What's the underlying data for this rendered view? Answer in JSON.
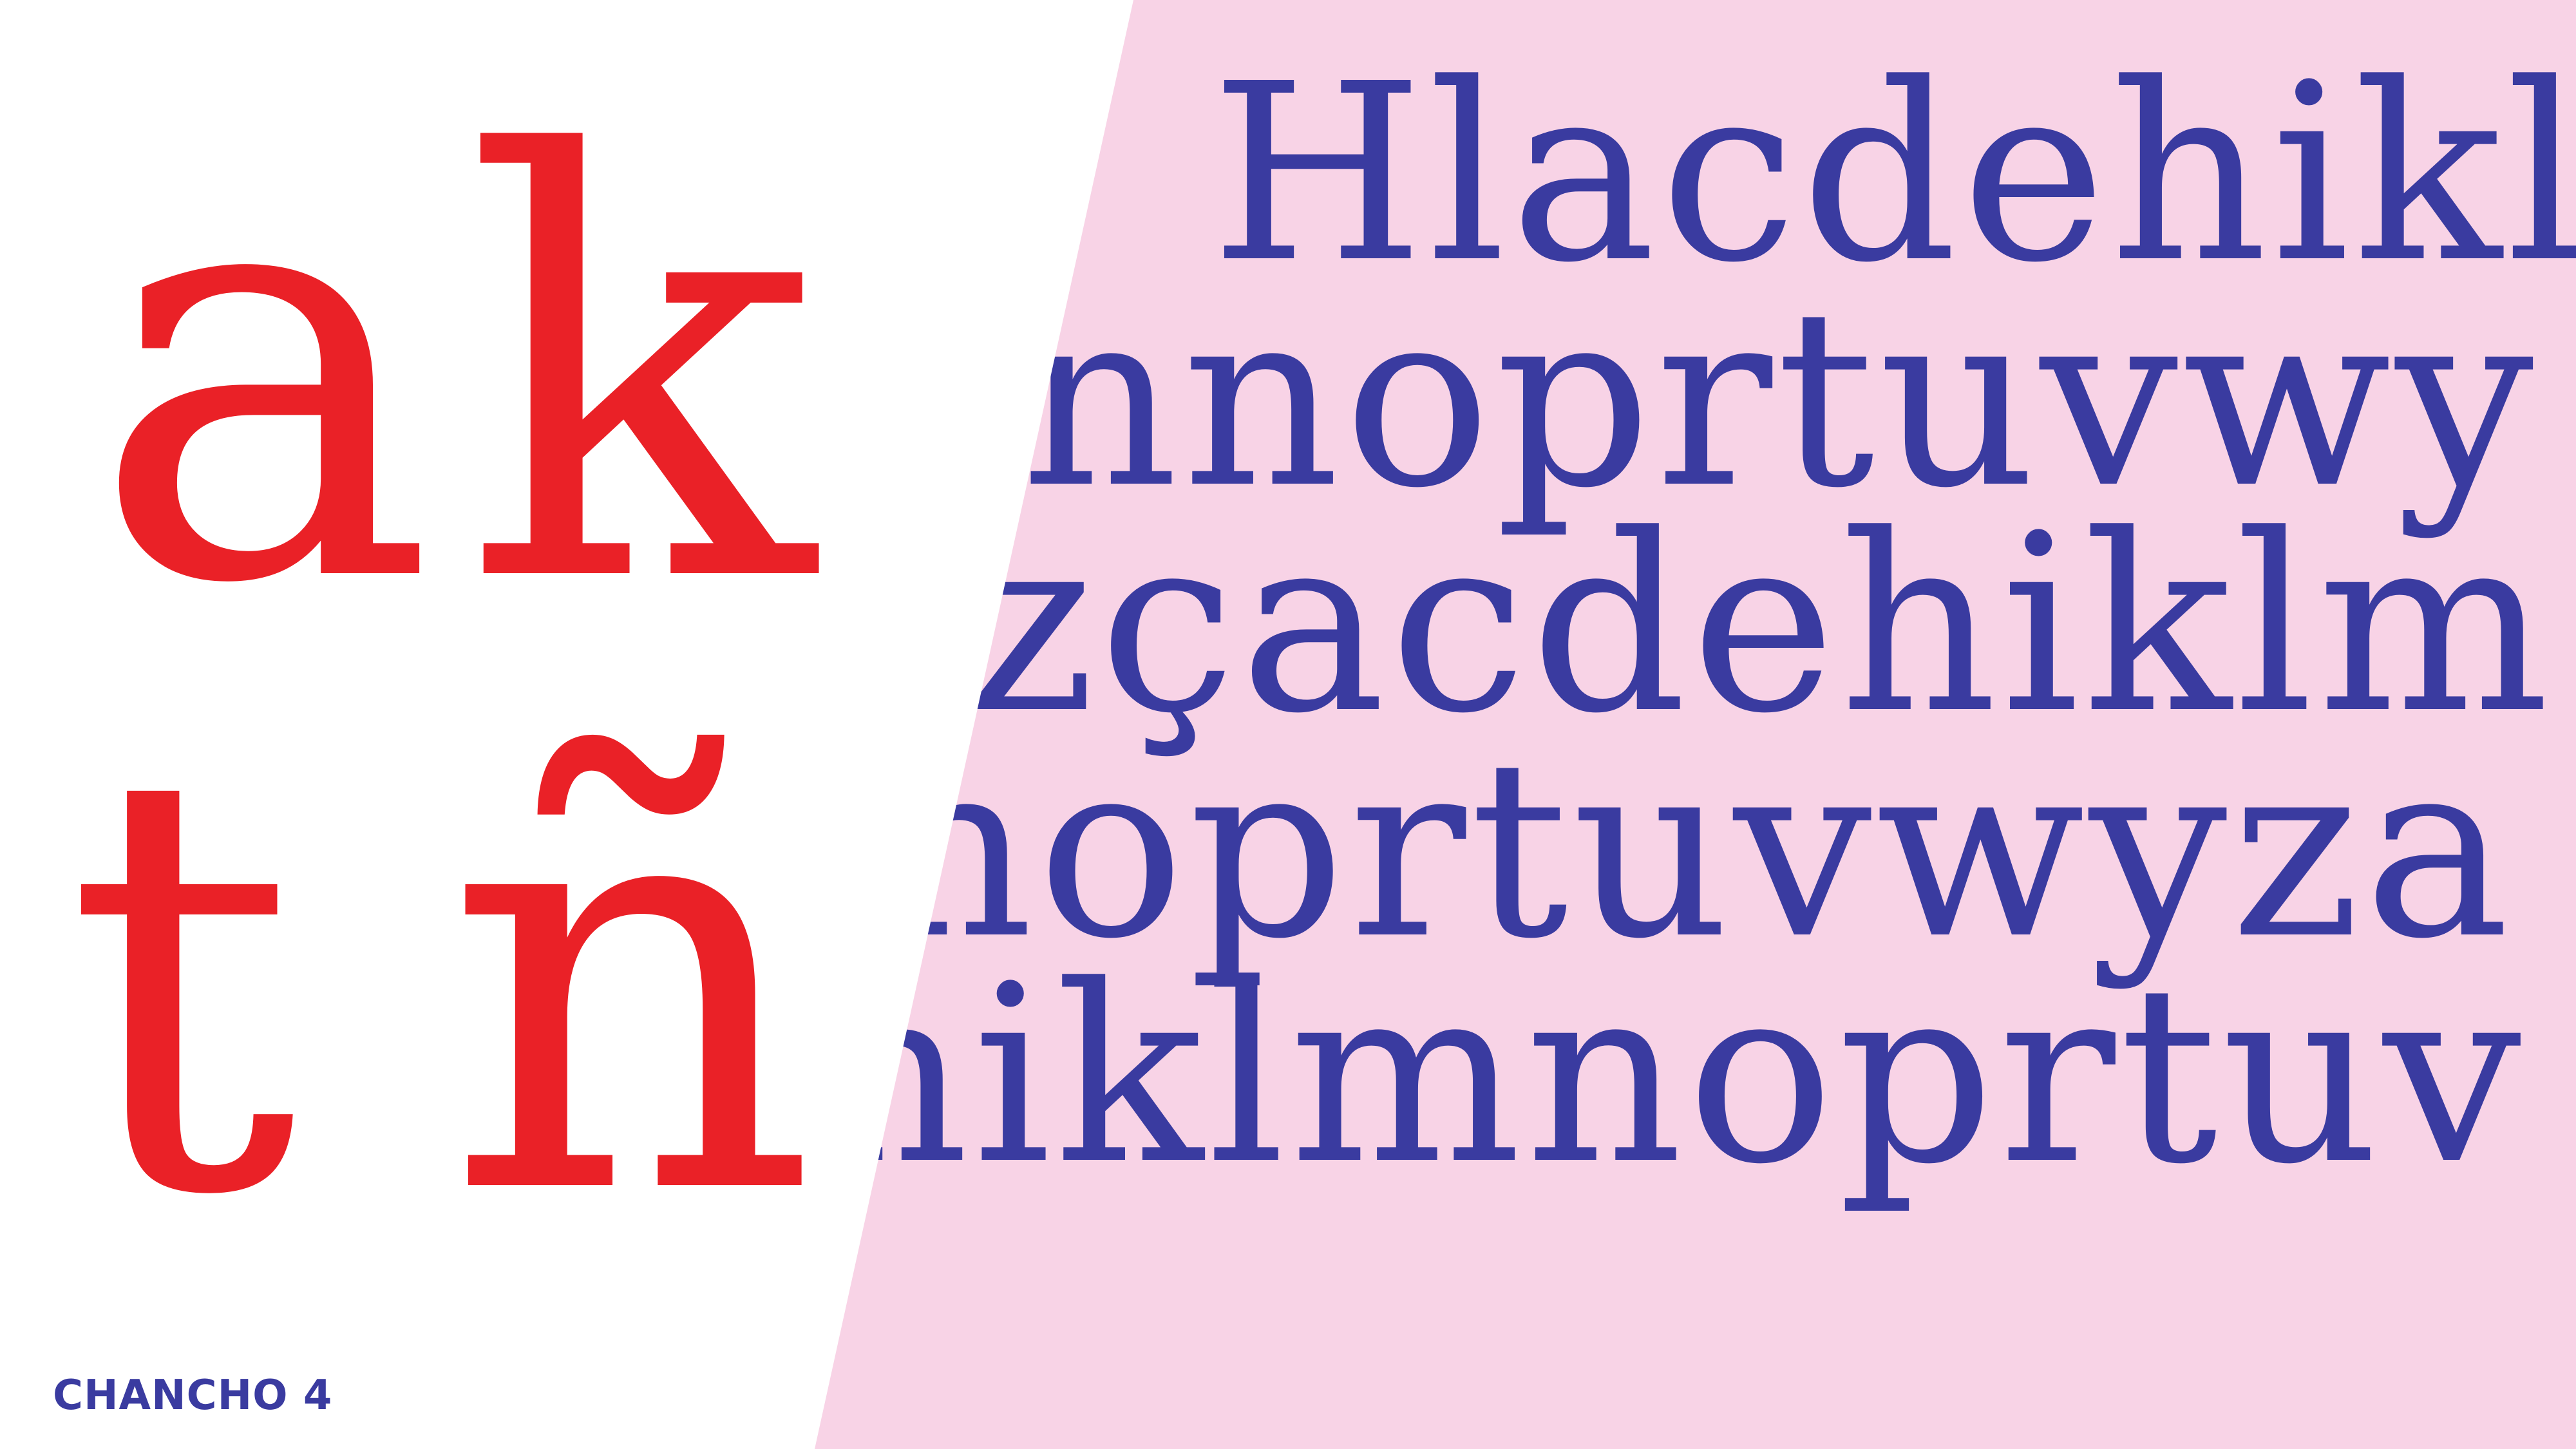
{
  "specimen": {
    "lines": [
      "Hlacdehikl",
      "nnoprtuvwy",
      "zçacdehiklm",
      "noprtuvwyza",
      "hiklmnoprtuv"
    ]
  },
  "feature": {
    "glyphs": [
      "a",
      "k",
      "t",
      "ñ"
    ]
  },
  "caption": "CHANCHO 4",
  "colors": {
    "background": "#ffffff",
    "panel": "#f8d3e6",
    "glyph_red": "#ea2127",
    "specimen_blue": "#3a3ba0"
  }
}
